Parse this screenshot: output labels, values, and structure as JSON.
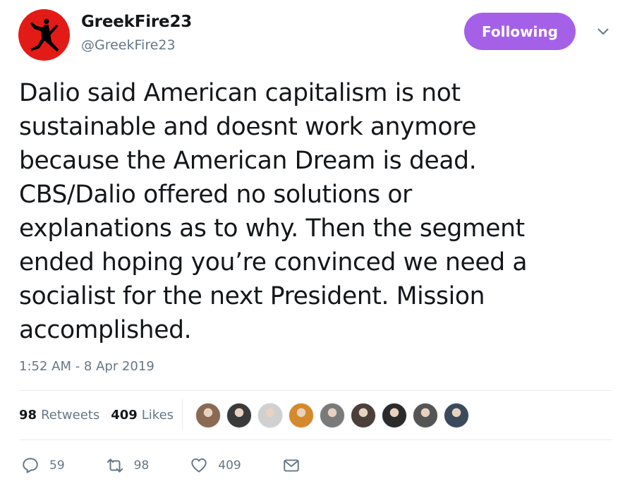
{
  "user": {
    "name": "GreekFire23",
    "handle": "@GreekFire23"
  },
  "follow_button": {
    "label": "Following",
    "color": "#a560e8"
  },
  "tweet": {
    "lines": [
      "Dalio said American capitalism is not",
      "sustainable and doesnt work anymore",
      "because the American Dream is dead.",
      "CBS/Dalio offered no solutions or",
      "explanations as to why. Then the segment",
      "ended hoping you’re convinced we need a",
      "socialist for the next President. Mission",
      "accomplished."
    ],
    "timestamp": "1:52 AM - 8 Apr 2019"
  },
  "stats": {
    "retweets_count": "98",
    "retweets_label": "Retweets",
    "likes_count": "409",
    "likes_label": "Likes"
  },
  "likers": [
    {
      "icon": "avatar-photo",
      "color": "#8a6a52"
    },
    {
      "icon": "avatar-photo",
      "color": "#3a3a3a"
    },
    {
      "icon": "avatar-photo",
      "color": "#d0d0d0"
    },
    {
      "icon": "avatar-photo",
      "color": "#d48a2a"
    },
    {
      "icon": "avatar-photo",
      "color": "#7a7a7a"
    },
    {
      "icon": "avatar-photo",
      "color": "#4a3f3a"
    },
    {
      "icon": "avatar-photo",
      "color": "#2b2b2b"
    },
    {
      "icon": "avatar-photo",
      "color": "#555555"
    },
    {
      "icon": "avatar-photo",
      "color": "#3b4a5a"
    }
  ],
  "actions": {
    "reply_count": "59",
    "retweet_count": "98",
    "like_count": "409"
  },
  "colors": {
    "muted": "#657786",
    "text": "#14171a",
    "avatar_bg": "#e31b17"
  }
}
